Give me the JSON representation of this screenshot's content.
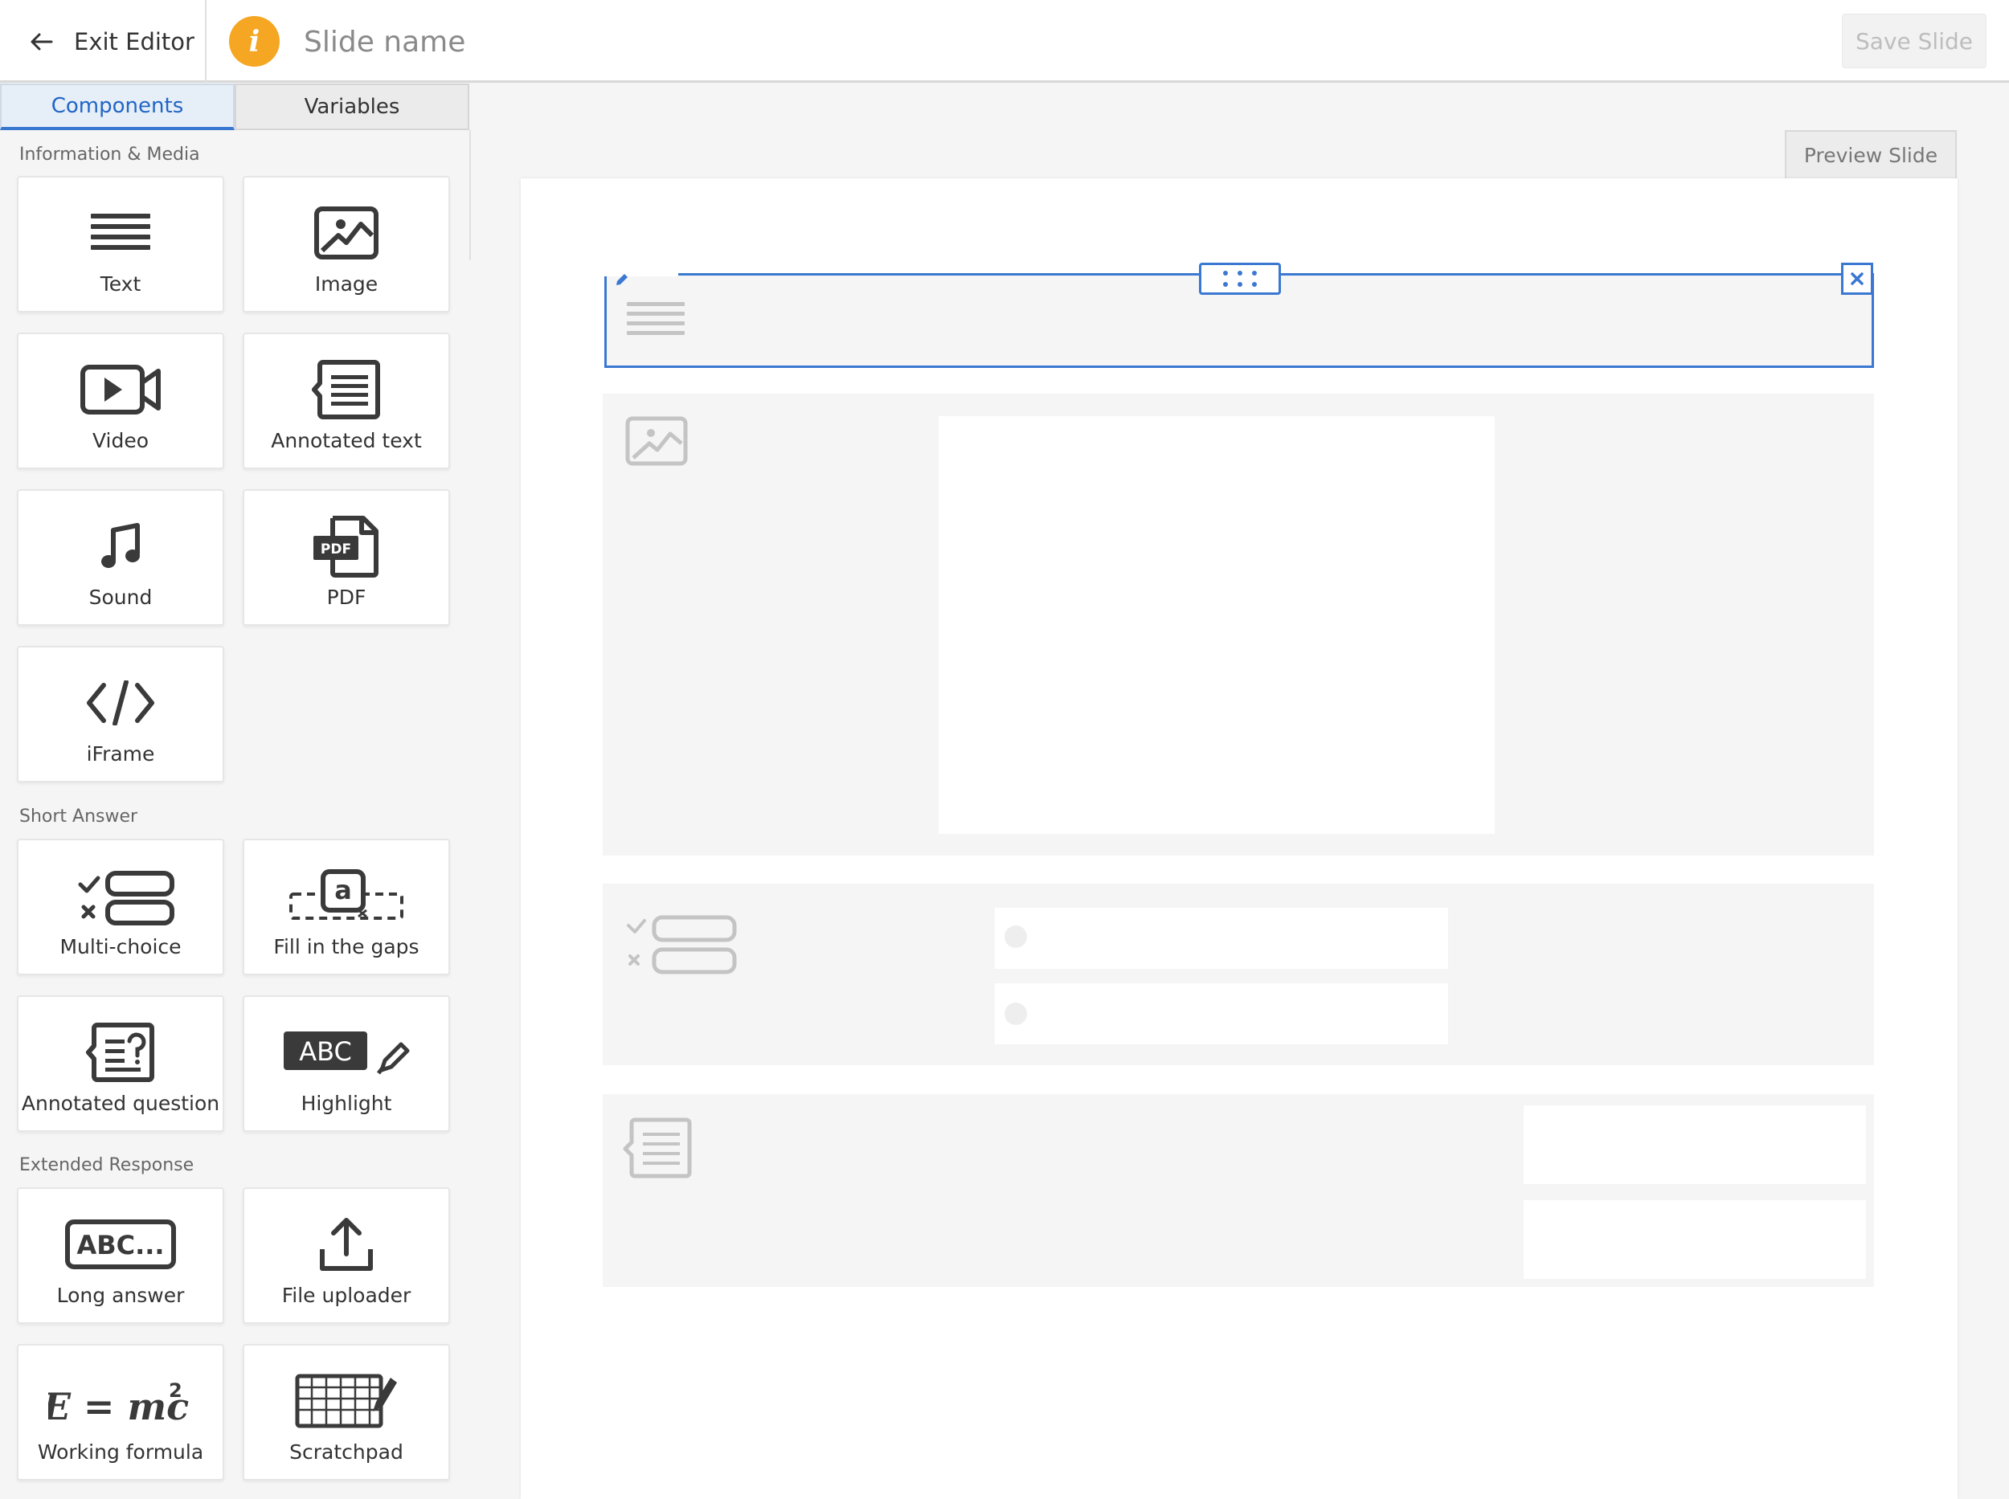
{
  "header": {
    "exit_label": "Exit Editor",
    "slide_name": "Slide name",
    "save_label": "Save Slide",
    "info_glyph": "i"
  },
  "tabs": {
    "components": "Components",
    "variables": "Variables",
    "active": "components"
  },
  "sections": [
    {
      "title": "Information & Media",
      "items": [
        {
          "label": "Text",
          "icon": "text-lines-icon"
        },
        {
          "label": "Image",
          "icon": "image-icon"
        },
        {
          "label": "Video",
          "icon": "video-camera-icon"
        },
        {
          "label": "Annotated text",
          "icon": "annotated-text-icon"
        },
        {
          "label": "Sound",
          "icon": "music-note-icon"
        },
        {
          "label": "PDF",
          "icon": "pdf-file-icon"
        },
        {
          "label": "iFrame",
          "icon": "code-brackets-icon"
        }
      ]
    },
    {
      "title": "Short Answer",
      "items": [
        {
          "label": "Multi-choice",
          "icon": "multi-choice-icon"
        },
        {
          "label": "Fill in the gaps",
          "icon": "fill-gaps-icon"
        },
        {
          "label": "Annotated question",
          "icon": "annotated-question-icon"
        },
        {
          "label": "Highlight",
          "icon": "highlight-abc-icon"
        }
      ]
    },
    {
      "title": "Extended Response",
      "items": [
        {
          "label": "Long answer",
          "icon": "long-answer-icon"
        },
        {
          "label": "File uploader",
          "icon": "upload-icon"
        },
        {
          "label": "Working formula",
          "icon": "formula-icon"
        },
        {
          "label": "Scratchpad",
          "icon": "scratchpad-icon"
        }
      ]
    }
  ],
  "canvas": {
    "preview_label": "Preview Slide"
  },
  "icon_text": {
    "pdf": "PDF",
    "fill": "a",
    "highlight": "ABC",
    "long_answer": "ABC...",
    "formula": "E = mc",
    "formula_exp": "2"
  },
  "colors": {
    "accent": "#3a78d1",
    "info": "#f5a623",
    "tab_active": "#2166c4"
  }
}
